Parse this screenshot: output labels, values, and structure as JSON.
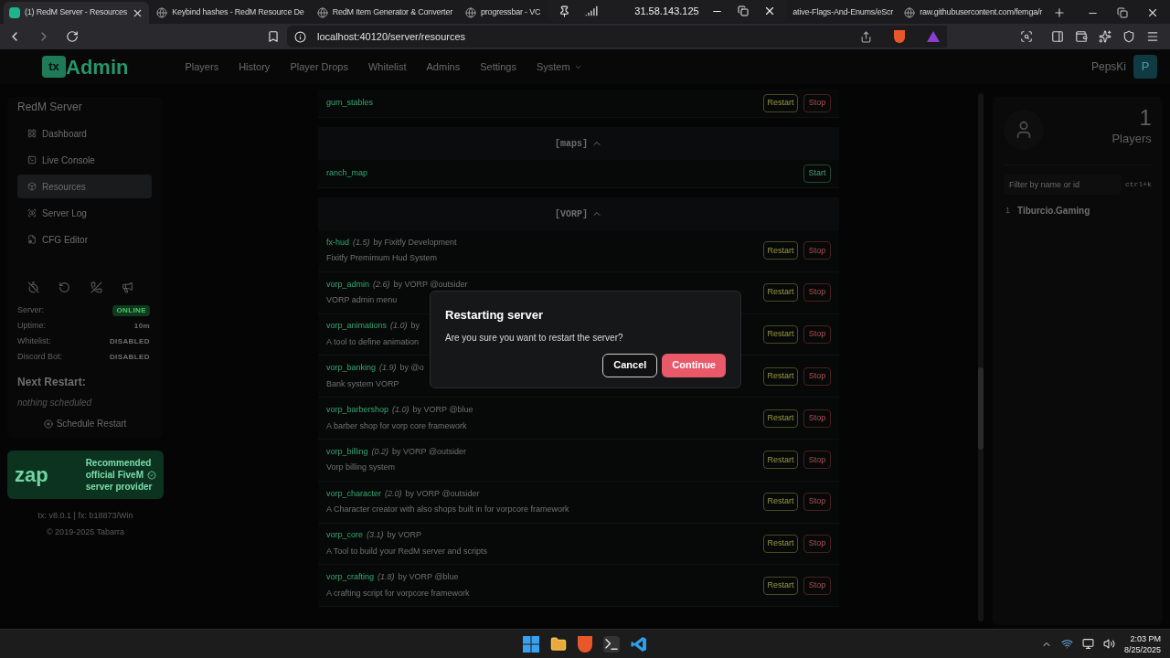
{
  "browser": {
    "tabs": [
      {
        "title": "(1) RedM Server - Resources",
        "selected": true
      },
      {
        "title": "Keybind hashes - RedM Resource De",
        "selected": false
      },
      {
        "title": "RedM Item Generator & Converter",
        "selected": false
      },
      {
        "title": "progressbar - VC",
        "selected": false
      },
      {
        "title": "ative-Flags-And-Enums/eScr",
        "selected": false
      },
      {
        "title": "raw.githubusercontent.com/femga/r",
        "selected": false
      }
    ],
    "url": "localhost:40120/server/resources"
  },
  "remote_bar": {
    "address": "31.58.143.125"
  },
  "header": {
    "logo": {
      "mark": "tx",
      "text": "Admin"
    },
    "nav": [
      {
        "label": "Players",
        "has_menu": false
      },
      {
        "label": "History",
        "has_menu": false
      },
      {
        "label": "Player Drops",
        "has_menu": false
      },
      {
        "label": "Whitelist",
        "has_menu": false
      },
      {
        "label": "Admins",
        "has_menu": false
      },
      {
        "label": "Settings",
        "has_menu": false
      },
      {
        "label": "System",
        "has_menu": true
      }
    ],
    "user": {
      "name": "PepsKi",
      "initial": "P"
    }
  },
  "sidebar": {
    "title": "RedM Server",
    "items": [
      {
        "label": "Dashboard",
        "selected": false
      },
      {
        "label": "Live Console",
        "selected": false
      },
      {
        "label": "Resources",
        "selected": true
      },
      {
        "label": "Server Log",
        "selected": false
      },
      {
        "label": "CFG Editor",
        "selected": false
      }
    ],
    "stats": [
      {
        "label": "Server:",
        "value": "ONLINE",
        "kind": "badge"
      },
      {
        "label": "Uptime:",
        "value": "10m",
        "kind": "text"
      },
      {
        "label": "Whitelist:",
        "value": "DISABLED",
        "kind": "text"
      },
      {
        "label": "Discord Bot:",
        "value": "DISABLED",
        "kind": "text"
      }
    ],
    "next_restart": {
      "title": "Next Restart:",
      "value": "nothing scheduled",
      "button": "Schedule Restart"
    },
    "ad": {
      "logo": "zap",
      "lines": [
        "Recommended",
        "official FiveM",
        "server provider"
      ]
    },
    "footer": [
      "tx: v8.0.1 | fx: b18873/Win",
      "© 2019-2025 Tabarra"
    ]
  },
  "resources": [
    {
      "kind": "resource",
      "name": "gum_stables",
      "buttons": [
        {
          "label": "Restart",
          "kind": "restart"
        },
        {
          "label": "Stop",
          "kind": "stop"
        }
      ]
    },
    {
      "kind": "group",
      "label": "[maps]",
      "expanded": true
    },
    {
      "kind": "resource",
      "name": "ranch_map",
      "buttons": [
        {
          "label": "Start",
          "kind": "start"
        }
      ]
    },
    {
      "kind": "group",
      "label": "[VORP]",
      "expanded": true
    },
    {
      "kind": "resource",
      "name": "fx-hud",
      "version": "(1.5)",
      "author": "by Fixitfy Development",
      "description": "Fixitfy Premimum Hud System",
      "buttons": [
        {
          "label": "Restart",
          "kind": "restart"
        },
        {
          "label": "Stop",
          "kind": "stop"
        }
      ]
    },
    {
      "kind": "resource",
      "name": "vorp_admin",
      "version": "(2.6)",
      "author": "by VORP @outsider",
      "description": "VORP admin menu",
      "buttons": [
        {
          "label": "Restart",
          "kind": "restart"
        },
        {
          "label": "Stop",
          "kind": "stop"
        }
      ]
    },
    {
      "kind": "resource",
      "name": "vorp_animations",
      "version": "(1.0)",
      "author": "by",
      "description": "A tool to define animation",
      "buttons": [
        {
          "label": "Restart",
          "kind": "restart"
        },
        {
          "label": "Stop",
          "kind": "stop"
        }
      ]
    },
    {
      "kind": "resource",
      "name": "vorp_banking",
      "version": "(1.9)",
      "author": "by @o",
      "description": "Bank system VORP",
      "buttons": [
        {
          "label": "Restart",
          "kind": "restart"
        },
        {
          "label": "Stop",
          "kind": "stop"
        }
      ]
    },
    {
      "kind": "resource",
      "name": "vorp_barbershop",
      "version": "(1.0)",
      "author": "by VORP @blue",
      "description": "A barber shop for vorp core framework",
      "buttons": [
        {
          "label": "Restart",
          "kind": "restart"
        },
        {
          "label": "Stop",
          "kind": "stop"
        }
      ]
    },
    {
      "kind": "resource",
      "name": "vorp_billing",
      "version": "(0.2)",
      "author": "by VORP @outsider",
      "description": "Vorp billing system",
      "buttons": [
        {
          "label": "Restart",
          "kind": "restart"
        },
        {
          "label": "Stop",
          "kind": "stop"
        }
      ]
    },
    {
      "kind": "resource",
      "name": "vorp_character",
      "version": "(2.0)",
      "author": "by VORP @outsider",
      "description": "A Character creator with also shops built in for vorpcore framework",
      "buttons": [
        {
          "label": "Restart",
          "kind": "restart"
        },
        {
          "label": "Stop",
          "kind": "stop"
        }
      ]
    },
    {
      "kind": "resource",
      "name": "vorp_core",
      "version": "(3.1)",
      "author": "by VORP",
      "description": "A Tool to build your RedM server and scripts",
      "buttons": [
        {
          "label": "Restart",
          "kind": "restart"
        },
        {
          "label": "Stop",
          "kind": "stop"
        }
      ]
    },
    {
      "kind": "resource",
      "name": "vorp_crafting",
      "version": "(1.8)",
      "author": "by VORP @blue",
      "description": "A crafting script for vorpcore framework",
      "buttons": [
        {
          "label": "Restart",
          "kind": "restart"
        },
        {
          "label": "Stop",
          "kind": "stop"
        }
      ]
    }
  ],
  "players": {
    "count": "1",
    "label": "Players",
    "filter_placeholder": "Filter by name or id",
    "shortcut": "ctrl+k",
    "list": [
      {
        "id": "1",
        "name": "Tiburcio.Gaming"
      }
    ]
  },
  "dialog": {
    "title": "Restarting server",
    "message": "Are you sure you want to restart the server?",
    "buttons": [
      {
        "label": "Cancel",
        "kind": "secondary"
      },
      {
        "label": "Continue",
        "kind": "primary"
      }
    ]
  },
  "taskbar": {
    "time": "2:03 PM",
    "date": "8/25/2025"
  }
}
